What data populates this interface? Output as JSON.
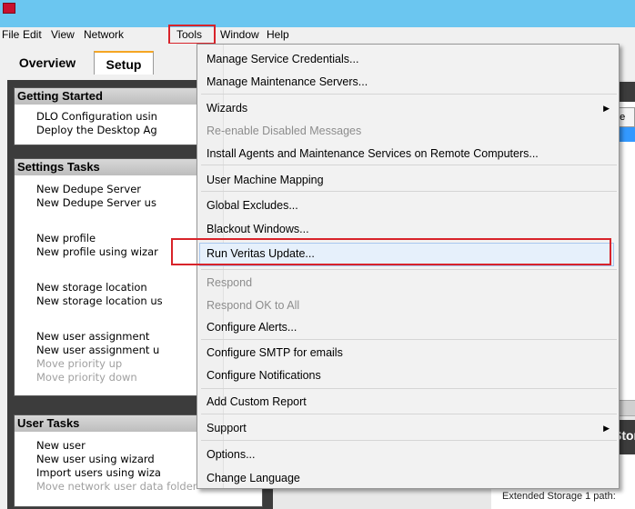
{
  "menubar": [
    "File",
    "Edit",
    "View",
    "Network",
    "Tools",
    "Window",
    "Help"
  ],
  "tabs": [
    "Overview",
    "Setup"
  ],
  "left_sections": [
    {
      "title": "Getting Started",
      "items": [
        {
          "label": "DLO Configuration usin",
          "disabled": false
        },
        {
          "label": "Deploy the Desktop Ag",
          "disabled": false
        }
      ]
    },
    {
      "title": "Settings Tasks",
      "items": [
        {
          "label": "New Dedupe Server",
          "disabled": false
        },
        {
          "label": "New Dedupe Server us",
          "disabled": false
        },
        {
          "label": "New profile",
          "disabled": false
        },
        {
          "label": "New profile using wizar",
          "disabled": false
        },
        {
          "label": "New storage location",
          "disabled": false
        },
        {
          "label": "New storage location us",
          "disabled": false
        },
        {
          "label": "New user assignment",
          "disabled": false
        },
        {
          "label": "New user assignment u",
          "disabled": false
        },
        {
          "label": "Move priority up",
          "disabled": true
        },
        {
          "label": "Move priority down",
          "disabled": true
        }
      ]
    },
    {
      "title": "User Tasks",
      "items": [
        {
          "label": "New user",
          "disabled": false
        },
        {
          "label": "New user using wizard",
          "disabled": false
        },
        {
          "label": "Import users using wiza",
          "disabled": false
        },
        {
          "label": "Move network user data folder",
          "disabled": true
        }
      ]
    }
  ],
  "right": {
    "col_header": "me",
    "stor_header": "Stor",
    "grid_header": "n",
    "grid_cell": "Extended Storage 1 path:"
  },
  "tools_menu": [
    {
      "label": "Manage Service Credentials...",
      "disabled": false
    },
    {
      "label": "Manage Maintenance Servers...",
      "disabled": false
    },
    {
      "label": "Wizards",
      "disabled": false,
      "submenu": true
    },
    {
      "label": "Re-enable Disabled Messages",
      "disabled": true
    },
    {
      "label": "Install Agents and Maintenance Services on Remote Computers...",
      "disabled": false
    },
    {
      "label": "User Machine Mapping",
      "disabled": false
    },
    {
      "label": "Global Excludes...",
      "disabled": false
    },
    {
      "label": "Blackout Windows...",
      "disabled": false
    },
    {
      "label": "Run Veritas Update...",
      "disabled": false,
      "highlighted": true
    },
    {
      "label": "Respond",
      "disabled": true
    },
    {
      "label": "Respond OK to All",
      "disabled": true
    },
    {
      "label": "Configure Alerts...",
      "disabled": false
    },
    {
      "label": "Configure SMTP for emails",
      "disabled": false
    },
    {
      "label": "Configure Notifications",
      "disabled": false
    },
    {
      "label": "Add Custom Report",
      "disabled": false
    },
    {
      "label": "Support",
      "disabled": false,
      "submenu": true
    },
    {
      "label": "Options...",
      "disabled": false
    },
    {
      "label": "Change Language",
      "disabled": false
    }
  ]
}
